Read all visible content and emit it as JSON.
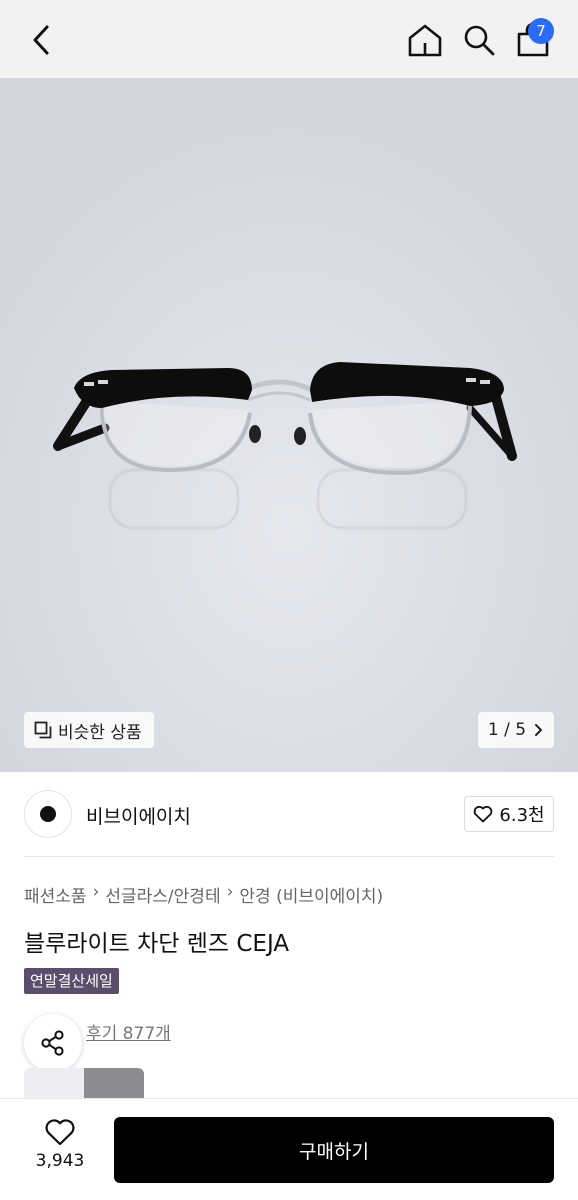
{
  "header": {
    "cart_count": "7",
    "icons": [
      "back-icon",
      "home-icon",
      "search-icon",
      "shopping-bag-icon"
    ]
  },
  "hero": {
    "similar_label": "비슷한 상품",
    "pager": "1 / 5"
  },
  "brand": {
    "name": "비브이에이치",
    "likes": "6.3천"
  },
  "product": {
    "breadcrumb": [
      "패션소품",
      "선글라스/안경테",
      "안경 (비브이에이치)"
    ],
    "title": "블루라이트 차단 렌즈 CEJA",
    "badge": "연말결산세일",
    "review_link": "후기 877개"
  },
  "bottom": {
    "wish_count": "3,943",
    "buy_label": "구매하기"
  },
  "colors": {
    "accent_badge": "#2a6cf6",
    "sale_badge": "#5b4d6b",
    "buy_button": "#000000"
  }
}
